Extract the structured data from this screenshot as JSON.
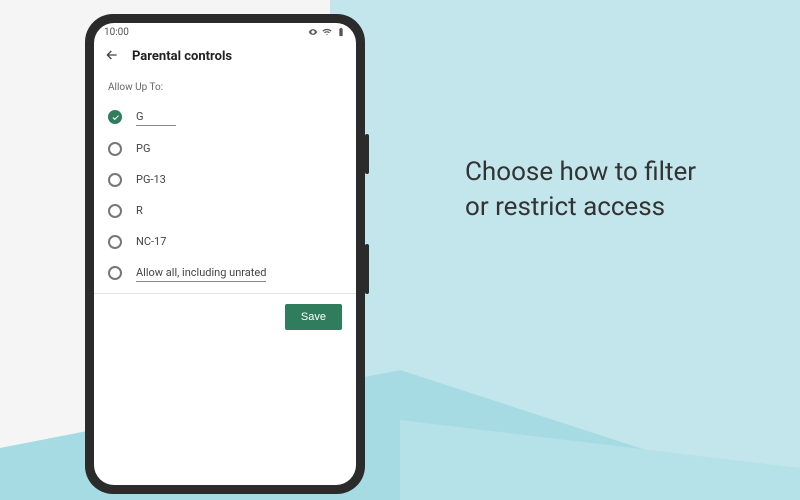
{
  "promo": {
    "line1": "Choose how to filter",
    "line2": "or restrict access"
  },
  "statusbar": {
    "time": "10:00"
  },
  "appbar": {
    "title": "Parental controls"
  },
  "section_label": "Allow Up To:",
  "options": [
    {
      "label": "G",
      "selected": true
    },
    {
      "label": "PG",
      "selected": false
    },
    {
      "label": "PG-13",
      "selected": false
    },
    {
      "label": "R",
      "selected": false
    },
    {
      "label": "NC-17",
      "selected": false
    },
    {
      "label": "Allow all, including unrated",
      "selected": false
    }
  ],
  "save_label": "Save",
  "colors": {
    "accent": "#2f7d5c"
  }
}
